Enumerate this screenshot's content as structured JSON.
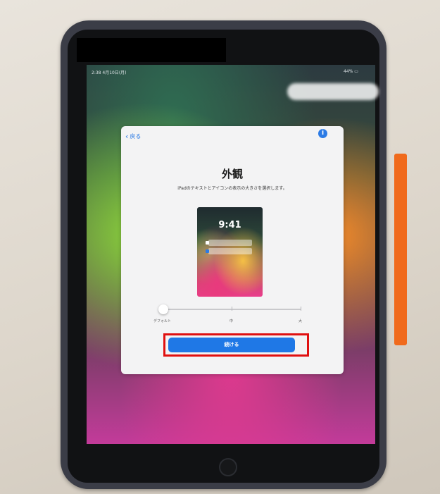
{
  "status_bar": {
    "time_date": "2:38 4月10日(月)",
    "battery": "44% ▭"
  },
  "setup_screen": {
    "back_label": "戻る",
    "info_icon": "i",
    "title": "外観",
    "subtitle": "iPadのテキストとアイコンの表示の大きさを選択します。",
    "preview": {
      "time": "9:41"
    },
    "text_size_slider": {
      "labels": [
        "デフォルト",
        "中",
        "大"
      ],
      "selected": "デフォルト"
    },
    "continue_button": "続ける"
  },
  "colors": {
    "accent": "#1f78e6",
    "highlight_box": "#e01010",
    "card_background": "#f3f3f4",
    "case": "#3b3d47",
    "strap": "#f06a1c"
  }
}
